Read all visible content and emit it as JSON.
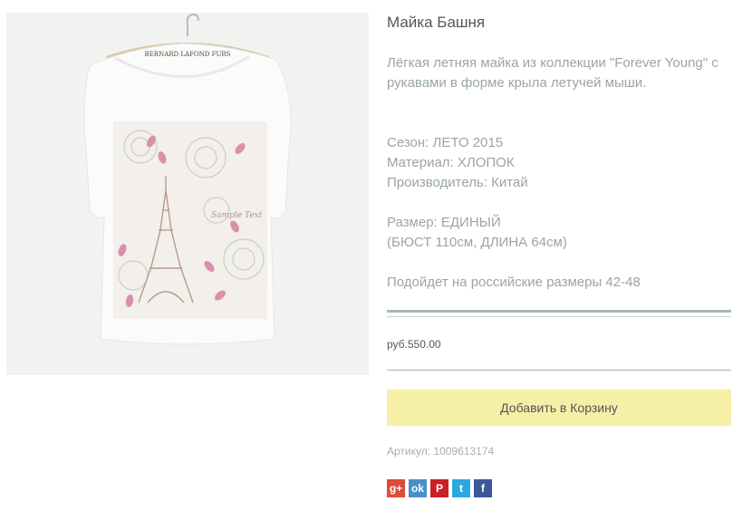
{
  "product": {
    "title": "Майка Башня",
    "image_alt": "Белая футболка с принтом Эйфелевой башни",
    "image_label": "BERNARD LAFOND FURS",
    "description": "Лёгкая летняя майка из коллекции \"Forever Young\" с рукавами в форме крыла летучей мыши.",
    "specs": [
      "Сезон: ЛЕТО 2015",
      "Материал: ХЛОПОК",
      "Производитель: Китай"
    ],
    "size": [
      "Размер: ЕДИНЫЙ",
      "(БЮСТ 110см, ДЛИНА 64см)"
    ],
    "fit_note": "Подойдет на российские размеры 42-48",
    "price": "руб.550.00",
    "add_to_cart_label": "Добавить в Корзину",
    "sku": "Артикул: 1009613174"
  },
  "share": [
    {
      "icon": "google-plus-icon",
      "glyph": "g+",
      "color": "#dd4b39"
    },
    {
      "icon": "odnoklassniki-icon",
      "glyph": "ok",
      "color": "#4a90c8"
    },
    {
      "icon": "pinterest-icon",
      "glyph": "P",
      "color": "#cb2027"
    },
    {
      "icon": "twitter-icon",
      "glyph": "t",
      "color": "#2aa9e0"
    },
    {
      "icon": "facebook-icon",
      "glyph": "f",
      "color": "#3b5998"
    }
  ],
  "colors": {
    "text_muted": "#9aa6a1",
    "title": "#555555",
    "button_bg": "#f5efa8",
    "rule": "#a9b6b0"
  }
}
